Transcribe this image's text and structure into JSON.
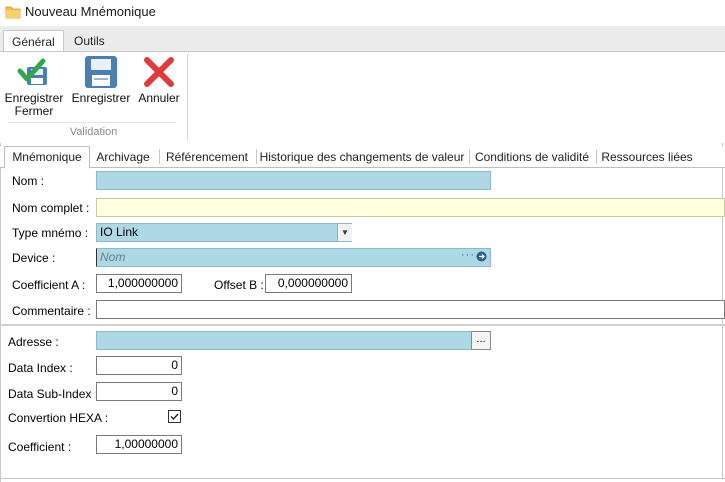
{
  "window": {
    "title": "Nouveau Mnémonique"
  },
  "ribbon": {
    "tabs": [
      "Général",
      "Outils"
    ],
    "buttons": {
      "save_close": "Enregistrer\nFermer",
      "save": "Enregistrer",
      "cancel": "Annuler"
    },
    "group_label": "Validation"
  },
  "form_tabs": [
    "Mnémonique",
    "Archivage",
    "Référencement",
    "Historique des changements de valeur",
    "Conditions de validité",
    "Ressources liées"
  ],
  "form": {
    "nom_label": "Nom :",
    "nom_value": "",
    "nom_complet_label": "Nom complet :",
    "nom_complet_value": "",
    "type_label": "Type mnémo :",
    "type_value": "IO Link",
    "device_label": "Device :",
    "device_placeholder": "Nom",
    "coef_a_label": "Coefficient A :",
    "coef_a_value": "1,000000000",
    "offset_b_label": "Offset B :",
    "offset_b_value": "0,000000000",
    "commentaire_label": "Commentaire :",
    "commentaire_value": ""
  },
  "iolink": {
    "adresse_label": "Adresse :",
    "adresse_button": "...",
    "data_index_label": "Data Index :",
    "data_index_value": "0",
    "data_subindex_label": "Data Sub-Index :",
    "data_subindex_value": "0",
    "hexa_label": "Convertion HEXA :",
    "hexa_checked": true,
    "coefficient_label": "Coefficient :",
    "coefficient_value": "1,00000000"
  },
  "colors": {
    "required_field": "#add8e6",
    "optional_field": "#ffffe0",
    "save_close_check": "#2fa84f",
    "cancel": "#e03b3b",
    "save_disk": "#4a7fb5"
  }
}
